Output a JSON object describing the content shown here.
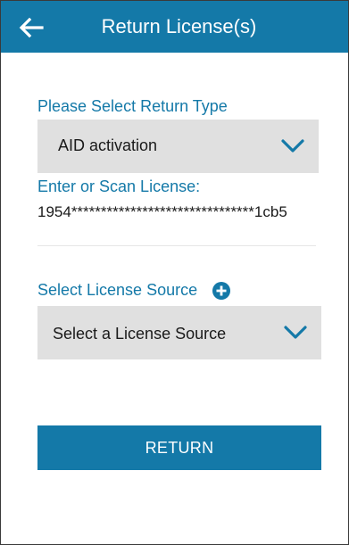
{
  "app_bar": {
    "title": "Return License(s)",
    "back_icon": "arrow-back-icon",
    "color": "#1479a8"
  },
  "return_type": {
    "label": "Please Select Return Type",
    "selected": "AID activation",
    "icon": "chevron-down-icon"
  },
  "license": {
    "label": "Enter or Scan License:",
    "value": "1954*******************************1cb5"
  },
  "license_source": {
    "label": "Select License Source",
    "add_icon": "plus-circle-icon",
    "selected": "Select a License Source",
    "icon": "chevron-down-icon"
  },
  "actions": {
    "return_label": "RETURN"
  },
  "colors": {
    "accent": "#1479a8",
    "select_bg": "#e0e0e0",
    "text": "#1a1a1a"
  }
}
